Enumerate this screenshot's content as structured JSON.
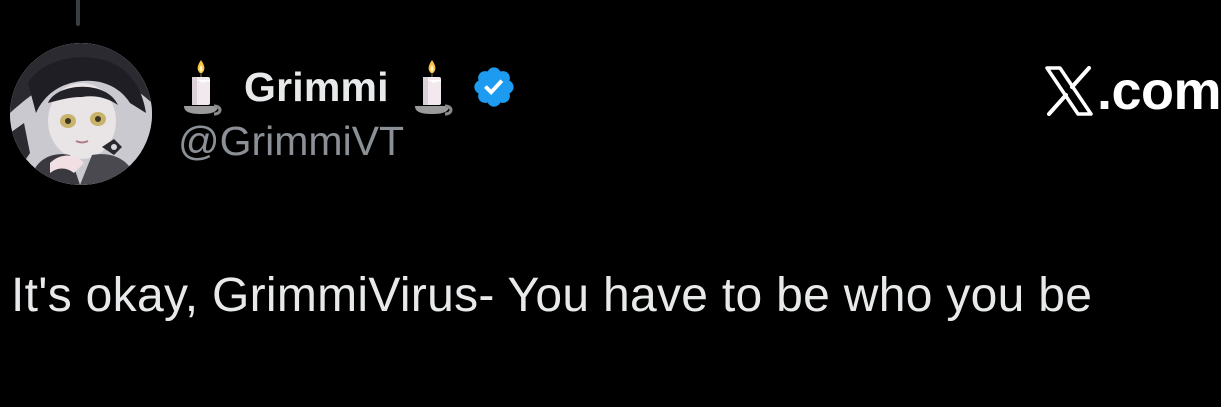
{
  "post": {
    "author": {
      "display_name": "Grimmi",
      "handle": "@GrimmiVT",
      "verified": true,
      "name_decoration_icon": "candle-icon"
    },
    "brand": {
      "label": ".com",
      "icon": "x-logo-icon"
    },
    "text": "It's okay, GrimmiVirus- You have to be who you be"
  },
  "colors": {
    "background": "#000000",
    "primary_text": "#e7e9ea",
    "secondary_text": "#8b9096",
    "verified_badge": "#1d9bf0"
  }
}
